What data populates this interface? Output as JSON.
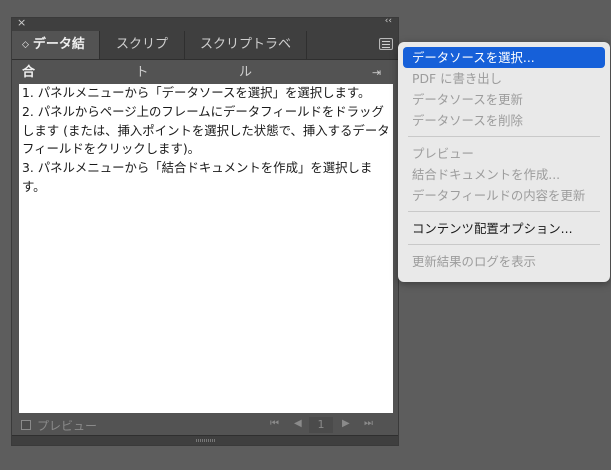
{
  "panel": {
    "tabs": [
      {
        "label": "データ結合",
        "active": true
      },
      {
        "label": "スクリプト",
        "active": false
      },
      {
        "label": "スクリプトラベル",
        "active": false
      }
    ],
    "close_glyph": "×",
    "collapse_glyph": "‹‹",
    "instructions": [
      "1. パネルメニューから「データソースを選択」を選択します。",
      "2. パネルからページ上のフレームにデータフィールドをドラッグします (または、挿入ポイントを選択した状態で、挿入するデータフィールドをクリックします)。",
      "3. パネルメニューから「結合ドキュメントを作成」を選択します。"
    ],
    "footer": {
      "preview_label": "プレビュー",
      "record_number": "1"
    }
  },
  "menu": {
    "items": [
      {
        "label": "データソースを選択...",
        "state": "selected"
      },
      {
        "label": "PDF に書き出し",
        "state": "disabled"
      },
      {
        "label": "データソースを更新",
        "state": "disabled"
      },
      {
        "label": "データソースを削除",
        "state": "disabled"
      },
      {
        "label": "プレビュー",
        "state": "disabled"
      },
      {
        "label": "結合ドキュメントを作成...",
        "state": "disabled"
      },
      {
        "label": "データフィールドの内容を更新",
        "state": "disabled"
      },
      {
        "label": "コンテンツ配置オプション...",
        "state": "enabled"
      },
      {
        "label": "更新結果のログを表示",
        "state": "disabled"
      }
    ]
  },
  "colors": {
    "background": "#5d5d5d",
    "panel": "#535353",
    "menu_background": "#e9e9e9",
    "selection": "#1660d9"
  }
}
